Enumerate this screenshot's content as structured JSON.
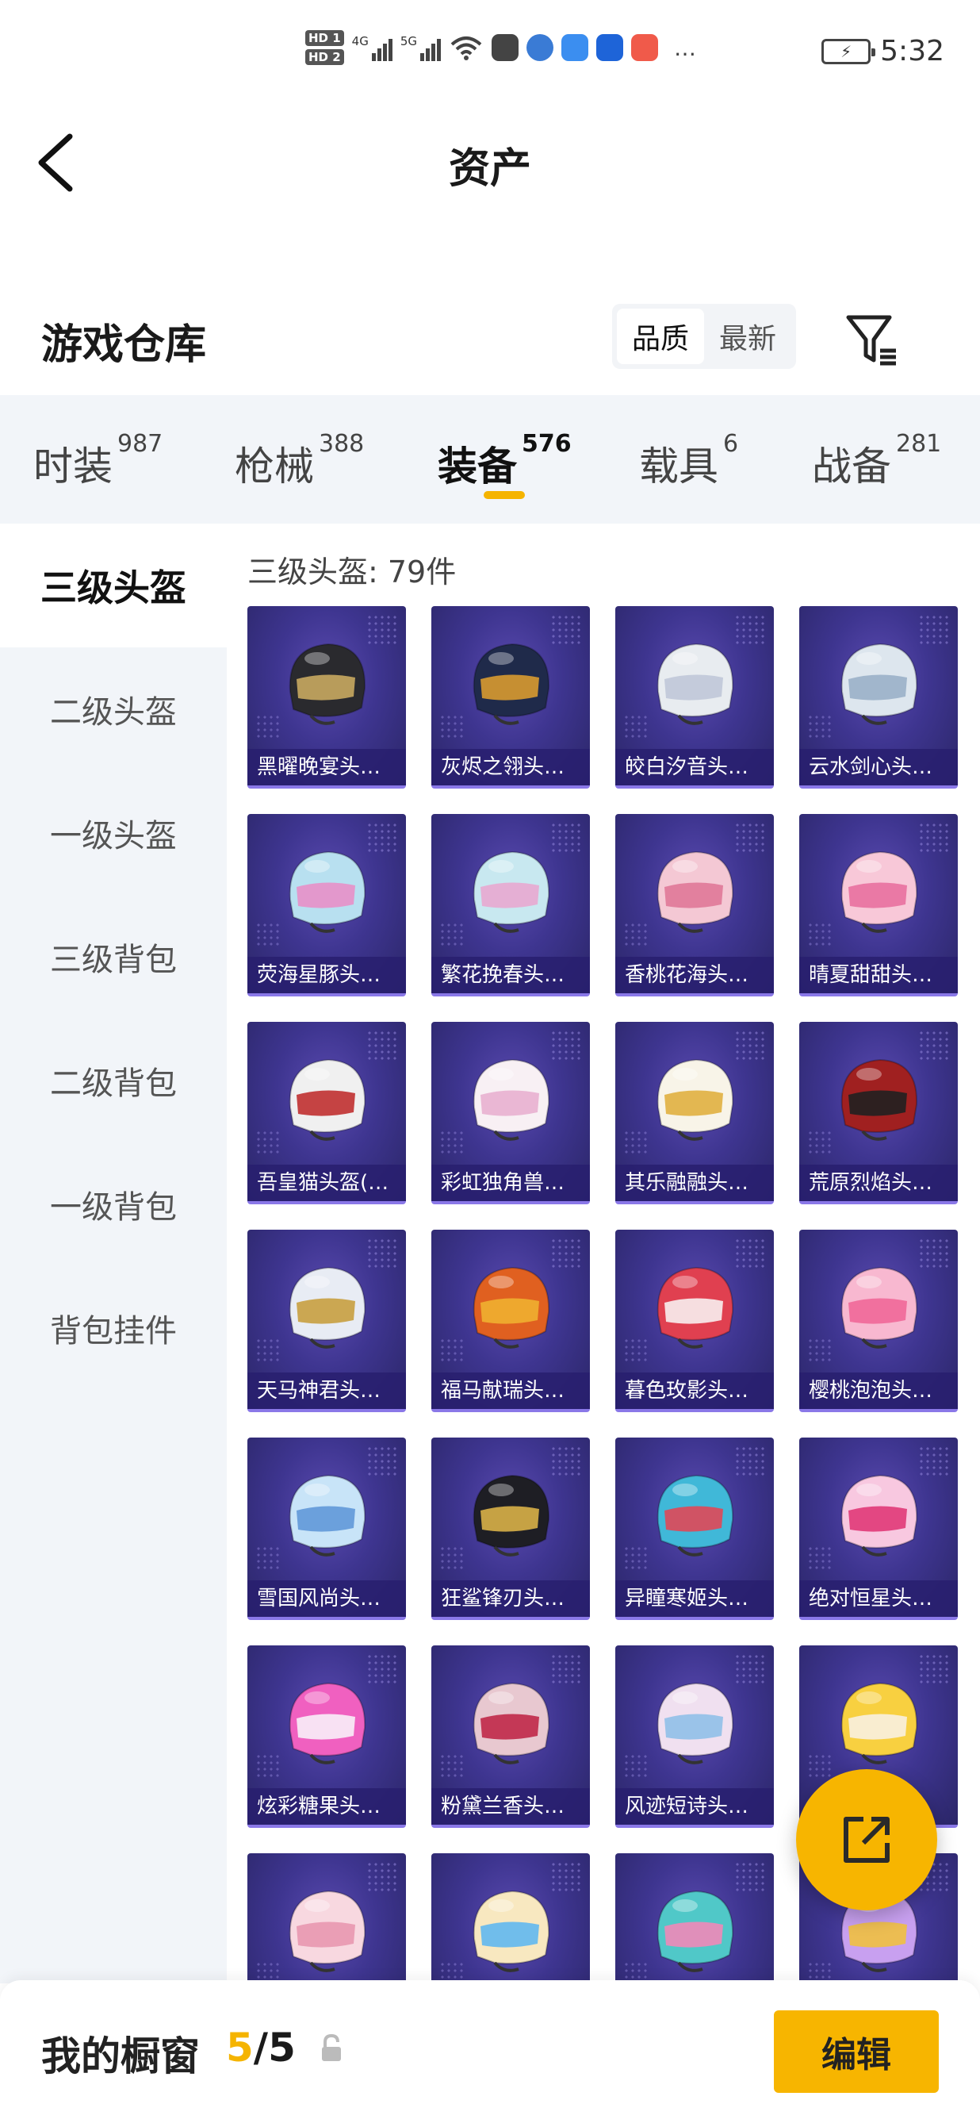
{
  "status_bar": {
    "time": "5:32",
    "hd1": "HD 1",
    "hd2": "HD 2",
    "net1": "4G",
    "net2": "5G",
    "wifi_label": "6",
    "more": "…"
  },
  "header": {
    "title": "资产"
  },
  "section": {
    "title": "游戏仓库",
    "sort_quality": "品质",
    "sort_latest": "最新"
  },
  "tabs": [
    {
      "label": "时装",
      "count": "987"
    },
    {
      "label": "枪械",
      "count": "388"
    },
    {
      "label": "装备",
      "count": "576"
    },
    {
      "label": "载具",
      "count": "6"
    },
    {
      "label": "战备",
      "count": "281"
    }
  ],
  "sidebar": [
    "三级头盔",
    "二级头盔",
    "一级头盔",
    "三级背包",
    "二级背包",
    "一级背包",
    "背包挂件"
  ],
  "count_label": "三级头盔: 79件",
  "items": [
    {
      "name": "黑曜晚宴头…",
      "color": "#2a2a2e",
      "accent": "#c8a860"
    },
    {
      "name": "灰烬之翎头…",
      "color": "#1f2a4a",
      "accent": "#d89a30"
    },
    {
      "name": "皎白汐音头…",
      "color": "#e8ecf0",
      "accent": "#c0c8d8"
    },
    {
      "name": "云水剑心头…",
      "color": "#dde6ee",
      "accent": "#9ab0c8"
    },
    {
      "name": "荧海星豚头…",
      "color": "#b8e0f0",
      "accent": "#e890c8"
    },
    {
      "name": "繁花挽春头…",
      "color": "#c8e8f0",
      "accent": "#e8a8d0"
    },
    {
      "name": "香桃花海头…",
      "color": "#f4c8d4",
      "accent": "#e07898"
    },
    {
      "name": "晴夏甜甜头…",
      "color": "#f8c8d8",
      "accent": "#e870a0"
    },
    {
      "name": "吾皇猫头盔(…",
      "color": "#f0f0f0",
      "accent": "#c03030"
    },
    {
      "name": "彩虹独角兽…",
      "color": "#f8f0f4",
      "accent": "#e8b0d0"
    },
    {
      "name": "其乐融融头…",
      "color": "#f8f4e8",
      "accent": "#e0b040"
    },
    {
      "name": "荒原烈焰头…",
      "color": "#a02020",
      "accent": "#202020"
    },
    {
      "name": "天马神君头…",
      "color": "#e8ecf4",
      "accent": "#c8a040"
    },
    {
      "name": "福马献瑞头…",
      "color": "#e06020",
      "accent": "#f0b030"
    },
    {
      "name": "暮色玫影头…",
      "color": "#e04050",
      "accent": "#f8f0f0"
    },
    {
      "name": "樱桃泡泡头…",
      "color": "#f8b8d0",
      "accent": "#f06898"
    },
    {
      "name": "雪国风尚头…",
      "color": "#c8e4f8",
      "accent": "#6098d8"
    },
    {
      "name": "狂鲨锋刃头…",
      "color": "#1e1e24",
      "accent": "#d8b048"
    },
    {
      "name": "异瞳寒姬头…",
      "color": "#40b8d8",
      "accent": "#e04858"
    },
    {
      "name": "绝对恒星头…",
      "color": "#f8c8e0",
      "accent": "#e03878"
    },
    {
      "name": "炫彩糖果头…",
      "color": "#f060c0",
      "accent": "#f8f0f8"
    },
    {
      "name": "粉黛兰香头…",
      "color": "#e8c8d0",
      "accent": "#c02848"
    },
    {
      "name": "风迹短诗头…",
      "color": "#f0e0f0",
      "accent": "#90c0e8"
    },
    {
      "name": "",
      "color": "#f8d040",
      "accent": "#f8f0e0"
    },
    {
      "name": "",
      "color": "#f8d8e0",
      "accent": "#e898b0"
    },
    {
      "name": "",
      "color": "#f8e8c0",
      "accent": "#60b8f0"
    },
    {
      "name": "",
      "color": "#50c8c8",
      "accent": "#f088b8"
    },
    {
      "name": "",
      "color": "#c8a0f0",
      "accent": "#f0c040"
    }
  ],
  "bottom_bar": {
    "label": "我的橱窗",
    "current": "5",
    "separator": "/",
    "total": "5",
    "edit_label": "编辑"
  },
  "colors": {
    "accent": "#f7b500",
    "card_bg": "#3e3590",
    "card_label_bg": "#281e6e"
  }
}
